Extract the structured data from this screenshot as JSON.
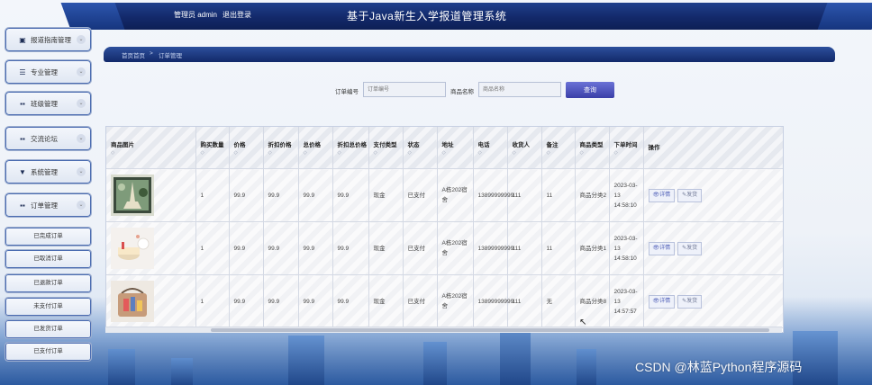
{
  "header": {
    "user_role": "管理员 admin",
    "logout_label": "退出登录",
    "title": "基于Java新生入学报道管理系统"
  },
  "sidebar": {
    "items": [
      {
        "icon": "document-icon",
        "glyph": "▣",
        "label": "报道指南管理"
      },
      {
        "icon": "list-icon",
        "glyph": "☰",
        "label": "专业管理"
      },
      {
        "icon": "grid-icon",
        "glyph": "▪▪",
        "label": "班级管理"
      },
      {
        "icon": "grid-icon",
        "glyph": "▪▪",
        "label": "交流论坛"
      },
      {
        "icon": "funnel-icon",
        "glyph": "▼",
        "label": "系统管理"
      },
      {
        "icon": "grid-icon",
        "glyph": "▪▪",
        "label": "订单管理"
      }
    ],
    "subitems": [
      "已完成订单",
      "已取消订单",
      "已退款订单",
      "未支付订单",
      "已发货订单",
      "已支付订单"
    ]
  },
  "breadcrumb": {
    "home": "首页首页",
    "separator": ">",
    "current": "订单管理"
  },
  "search": {
    "order_label": "订单编号",
    "order_placeholder": "订单编号",
    "product_label": "商品名称",
    "product_placeholder": "商品名称",
    "button": "查询"
  },
  "table": {
    "columns": [
      {
        "label": "商品图片",
        "sort": "◇"
      },
      {
        "label": "购买数量",
        "sort": "◇"
      },
      {
        "label": "价格",
        "sort": "◇"
      },
      {
        "label": "折扣价格",
        "sort": "◇"
      },
      {
        "label": "总价格",
        "sort": "◇"
      },
      {
        "label": "折扣总价格",
        "sort": "◇"
      },
      {
        "label": "支付类型",
        "sort": "◇"
      },
      {
        "label": "状态",
        "sort": "◇"
      },
      {
        "label": "地址",
        "sort": "◇"
      },
      {
        "label": "电话",
        "sort": "◇"
      },
      {
        "label": "收货人",
        "sort": "◇"
      },
      {
        "label": "备注",
        "sort": "◇"
      },
      {
        "label": "商品类型",
        "sort": "◇"
      },
      {
        "label": "下单时间",
        "sort": "◇"
      },
      {
        "label": "操作",
        "sort": ""
      }
    ],
    "rows": [
      {
        "image": "eiffel-tower-painting",
        "qty": "1",
        "price": "99.9",
        "discount_price": "99.9",
        "total": "99.9",
        "discount_total": "99.9",
        "pay_type": "现金",
        "status": "已支付",
        "address": "A栋202宿舍",
        "phone": "13899999999",
        "receiver": "111",
        "note": "11",
        "category": "商品分类2",
        "time": "2023-03-13 14:58:10"
      },
      {
        "image": "gift-box-photo",
        "qty": "1",
        "price": "99.9",
        "discount_price": "99.9",
        "total": "99.9",
        "discount_total": "99.9",
        "pay_type": "现金",
        "status": "已支付",
        "address": "A栋202宿舍",
        "phone": "13899999999",
        "receiver": "111",
        "note": "11",
        "category": "商品分类1",
        "time": "2023-03-13 14:58:10"
      },
      {
        "image": "handbag-photo",
        "qty": "1",
        "price": "99.9",
        "discount_price": "99.9",
        "total": "99.9",
        "discount_total": "99.9",
        "pay_type": "现金",
        "status": "已支付",
        "address": "A栋202宿舍",
        "phone": "13899999999",
        "receiver": "111",
        "note": "无",
        "category": "商品分类8",
        "time": "2023-03-13 14:57:57"
      }
    ],
    "actions": {
      "detail": "👁详情",
      "ship": "✎发货"
    }
  },
  "watermark": "CSDN @林蓝Python程序源码",
  "colors": {
    "header_bg": "#13296a",
    "search_button": "#4a50bd",
    "accent": "#4f5fb8"
  }
}
